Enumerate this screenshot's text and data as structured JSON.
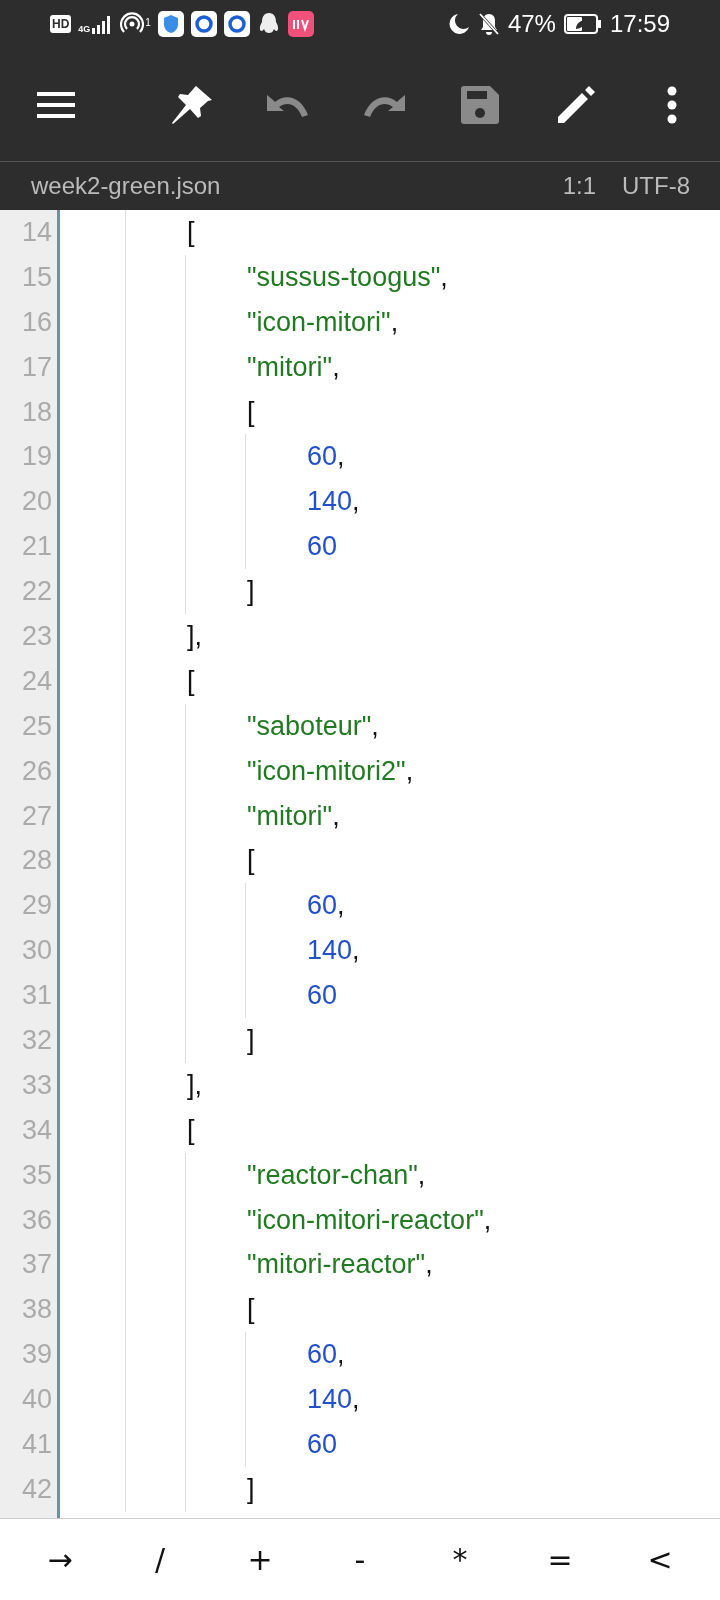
{
  "status_bar": {
    "hd": "HD",
    "network": "4G",
    "hotspot_count": "1",
    "battery": "47%",
    "time": "17:59"
  },
  "toolbar": {
    "buttons": [
      {
        "kind": "menu",
        "disabled": false
      },
      {
        "kind": "pin",
        "disabled": false
      },
      {
        "kind": "undo",
        "disabled": true
      },
      {
        "kind": "redo",
        "disabled": true
      },
      {
        "kind": "save",
        "disabled": true
      },
      {
        "kind": "edit",
        "disabled": false
      },
      {
        "kind": "more",
        "disabled": false
      }
    ]
  },
  "file_bar": {
    "filename": "week2-green.json",
    "position": "1:1",
    "encoding": "UTF-8"
  },
  "editor": {
    "lines": [
      {
        "number": "14",
        "tokens": [
          {
            "kind": "punct",
            "text": "["
          }
        ],
        "children": [
          {
            "number": "15",
            "tokens": [
              {
                "kind": "string",
                "text": "\"sussus-toogus\""
              },
              {
                "kind": "punct",
                "text": ","
              }
            ]
          },
          {
            "number": "16",
            "tokens": [
              {
                "kind": "string",
                "text": "\"icon-mitori\""
              },
              {
                "kind": "punct",
                "text": ","
              }
            ]
          },
          {
            "number": "17",
            "tokens": [
              {
                "kind": "string",
                "text": "\"mitori\""
              },
              {
                "kind": "punct",
                "text": ","
              }
            ]
          },
          {
            "number": "18",
            "tokens": [
              {
                "kind": "punct",
                "text": "["
              }
            ],
            "children": [
              {
                "number": "19",
                "tokens": [
                  {
                    "kind": "number",
                    "text": "60"
                  },
                  {
                    "kind": "punct",
                    "text": ","
                  }
                ]
              },
              {
                "number": "20",
                "tokens": [
                  {
                    "kind": "number",
                    "text": "140"
                  },
                  {
                    "kind": "punct",
                    "text": ","
                  }
                ]
              },
              {
                "number": "21",
                "tokens": [
                  {
                    "kind": "number",
                    "text": "60"
                  }
                ]
              }
            ]
          },
          {
            "number": "22",
            "tokens": [
              {
                "kind": "punct",
                "text": "]"
              }
            ]
          }
        ]
      },
      {
        "number": "23",
        "tokens": [
          {
            "kind": "punct",
            "text": "],"
          }
        ]
      },
      {
        "number": "24",
        "tokens": [
          {
            "kind": "punct",
            "text": "["
          }
        ],
        "children": [
          {
            "number": "25",
            "tokens": [
              {
                "kind": "string",
                "text": "\"saboteur\""
              },
              {
                "kind": "punct",
                "text": ","
              }
            ]
          },
          {
            "number": "26",
            "tokens": [
              {
                "kind": "string",
                "text": "\"icon-mitori2\""
              },
              {
                "kind": "punct",
                "text": ","
              }
            ]
          },
          {
            "number": "27",
            "tokens": [
              {
                "kind": "string",
                "text": "\"mitori\""
              },
              {
                "kind": "punct",
                "text": ","
              }
            ]
          },
          {
            "number": "28",
            "tokens": [
              {
                "kind": "punct",
                "text": "["
              }
            ],
            "children": [
              {
                "number": "29",
                "tokens": [
                  {
                    "kind": "number",
                    "text": "60"
                  },
                  {
                    "kind": "punct",
                    "text": ","
                  }
                ]
              },
              {
                "number": "30",
                "tokens": [
                  {
                    "kind": "number",
                    "text": "140"
                  },
                  {
                    "kind": "punct",
                    "text": ","
                  }
                ]
              },
              {
                "number": "31",
                "tokens": [
                  {
                    "kind": "number",
                    "text": "60"
                  }
                ]
              }
            ]
          },
          {
            "number": "32",
            "tokens": [
              {
                "kind": "punct",
                "text": "]"
              }
            ]
          }
        ]
      },
      {
        "number": "33",
        "tokens": [
          {
            "kind": "punct",
            "text": "],"
          }
        ]
      },
      {
        "number": "34",
        "tokens": [
          {
            "kind": "punct",
            "text": "["
          }
        ],
        "children": [
          {
            "number": "35",
            "tokens": [
              {
                "kind": "string",
                "text": "\"reactor-chan\""
              },
              {
                "kind": "punct",
                "text": ","
              }
            ]
          },
          {
            "number": "36",
            "tokens": [
              {
                "kind": "string",
                "text": "\"icon-mitori-reactor\""
              },
              {
                "kind": "punct",
                "text": ","
              }
            ]
          },
          {
            "number": "37",
            "tokens": [
              {
                "kind": "string",
                "text": "\"mitori-reactor\""
              },
              {
                "kind": "punct",
                "text": ","
              }
            ]
          },
          {
            "number": "38",
            "tokens": [
              {
                "kind": "punct",
                "text": "["
              }
            ],
            "children": [
              {
                "number": "39",
                "tokens": [
                  {
                    "kind": "number",
                    "text": "60"
                  },
                  {
                    "kind": "punct",
                    "text": ","
                  }
                ]
              },
              {
                "number": "40",
                "tokens": [
                  {
                    "kind": "number",
                    "text": "140"
                  },
                  {
                    "kind": "punct",
                    "text": ","
                  }
                ]
              },
              {
                "number": "41",
                "tokens": [
                  {
                    "kind": "number",
                    "text": "60"
                  }
                ]
              }
            ]
          },
          {
            "number": "42",
            "tokens": [
              {
                "kind": "punct",
                "text": "]"
              }
            ]
          }
        ]
      }
    ]
  },
  "symbol_bar": {
    "keys": [
      "→",
      "/",
      "+",
      "-",
      "*",
      "=",
      "<"
    ]
  }
}
